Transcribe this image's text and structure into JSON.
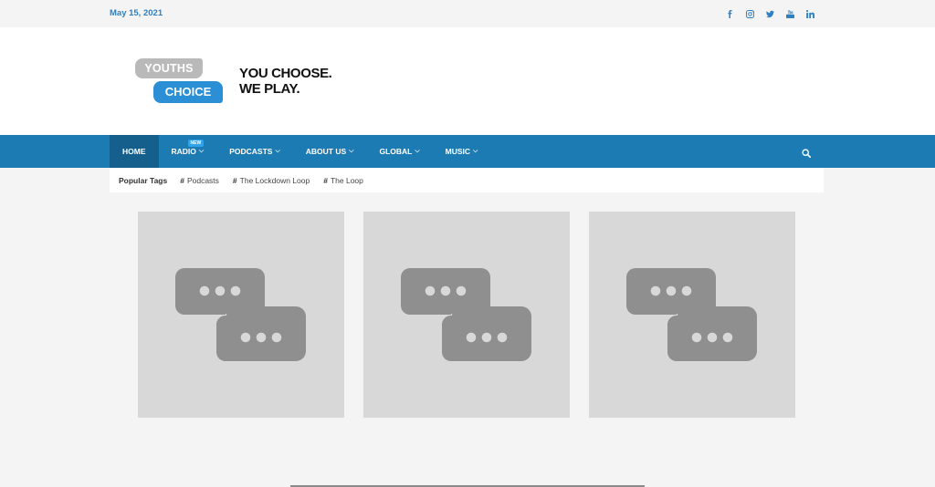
{
  "topbar": {
    "date": "May 15, 2021",
    "social": [
      {
        "icon": "facebook-icon"
      },
      {
        "icon": "instagram-icon"
      },
      {
        "icon": "twitter-icon"
      },
      {
        "icon": "youtube-icon"
      },
      {
        "icon": "linkedin-icon"
      }
    ]
  },
  "logo": {
    "top": "YOUTHS",
    "bottom": "CHOICE",
    "tagline_1": "YOU CHOOSE.",
    "tagline_2": "WE PLAY."
  },
  "nav": {
    "items": [
      {
        "label": "HOME",
        "active": true
      },
      {
        "label": "RADIO",
        "has_dropdown": true,
        "badge": "NEW"
      },
      {
        "label": "PODCASTS",
        "has_dropdown": true
      },
      {
        "label": "ABOUT US",
        "has_dropdown": true
      },
      {
        "label": "GLOBAL",
        "has_dropdown": true
      },
      {
        "label": "MUSIC",
        "has_dropdown": true
      }
    ],
    "search_icon": "search-icon"
  },
  "tags": {
    "label": "Popular Tags",
    "items": [
      "Podcasts",
      "The Lockdown Loop",
      "The Loop"
    ]
  },
  "cards": [
    {
      "icon": "chat-bubbles-icon"
    },
    {
      "icon": "chat-bubbles-icon"
    },
    {
      "icon": "chat-bubbles-icon"
    }
  ],
  "colors": {
    "accent": "#2f7fc1",
    "nav_bg": "#1d7bb4",
    "nav_active": "#155f8d",
    "logo_blue": "#2b8fd6",
    "logo_gray": "#b9b9b9",
    "placeholder_bg": "#d8d8d8",
    "placeholder_icon": "#8f8f8f"
  }
}
